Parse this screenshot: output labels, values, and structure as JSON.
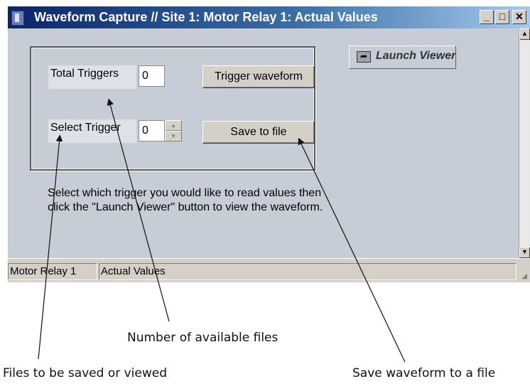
{
  "window": {
    "title": "Waveform Capture // Site 1: Motor Relay 1: Actual Values",
    "controls": {
      "minimize": "_",
      "maximize": "□",
      "close": "✕"
    }
  },
  "panel": {
    "total_triggers_label": "Total Triggers",
    "total_triggers_value": "0",
    "select_trigger_label": "Select Trigger",
    "select_trigger_value": "0",
    "trigger_waveform_button": "Trigger waveform",
    "save_to_file_button": "Save to file",
    "launch_viewer_button": "Launch Viewer",
    "help_text": "Select which trigger you would like to read values then click the \"Launch Viewer\" button to view the waveform."
  },
  "statusbar": {
    "device": "Motor Relay 1",
    "view": "Actual Values"
  },
  "annotations": {
    "available_files": "Number of available files",
    "files_saved": "Files to be saved or viewed",
    "save_waveform": "Save waveform to a file"
  },
  "icons": [
    "app-icon",
    "launch-viewer-icon",
    "scroll-up-icon",
    "scroll-down-icon",
    "resize-grip-icon"
  ]
}
